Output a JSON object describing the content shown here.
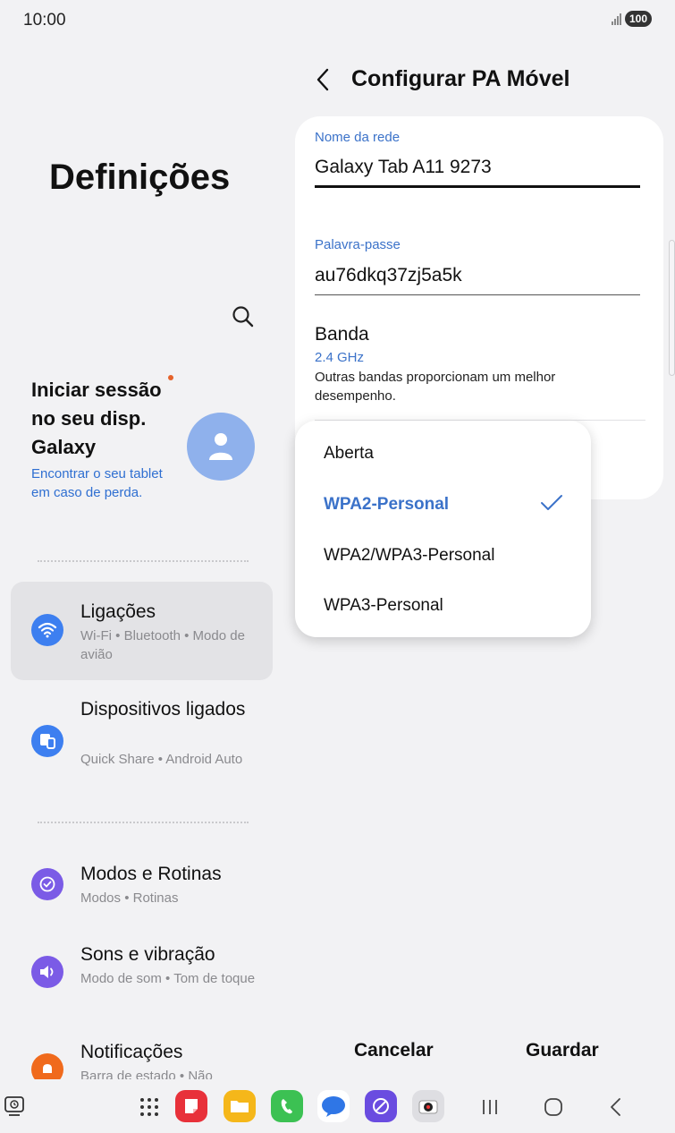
{
  "status": {
    "time": "10:00",
    "battery": "100"
  },
  "settings": {
    "title": "Definições",
    "signin": {
      "title": "Iniciar sessão no seu disp. Galaxy",
      "subtitle": "Encontrar o seu tablet em caso de perda."
    },
    "items": [
      {
        "title": "Ligações",
        "subtitle": "Wi-Fi • Bluetooth • Modo de avião",
        "icon_color": "#3d7ff0"
      },
      {
        "title": "Dispositivos ligados",
        "subtitle": "Quick Share • Android Auto",
        "icon_color": "#3d7ff0"
      },
      {
        "title": "Modos e Rotinas",
        "subtitle": "Modos • Rotinas",
        "icon_color": "#7b5be6"
      },
      {
        "title": "Sons e vibração",
        "subtitle": "Modo de som • Tom de toque",
        "icon_color": "#7b5be6"
      },
      {
        "title": "Notificações",
        "subtitle": "Barra de estado • Não",
        "icon_color": "#f06a1c"
      }
    ]
  },
  "hotspot": {
    "title": "Configurar PA Móvel",
    "network_name_label": "Nome da rede",
    "network_name_value": "Galaxy Tab A11 9273",
    "password_label": "Palavra-passe",
    "password_value": "au76dkq37zj5a5k",
    "band_title": "Banda",
    "band_value": "2.4 GHz",
    "band_description": "Outras bandas proporcionam um melhor desempenho.",
    "security_options": [
      "Aberta",
      "WPA2-Personal",
      "WPA2/WPA3-Personal",
      "WPA3-Personal"
    ],
    "selected_security": "WPA2-Personal",
    "cancel_label": "Cancelar",
    "save_label": "Guardar"
  },
  "colors": {
    "accent": "#3b72c9",
    "background": "#f2f2f4"
  }
}
